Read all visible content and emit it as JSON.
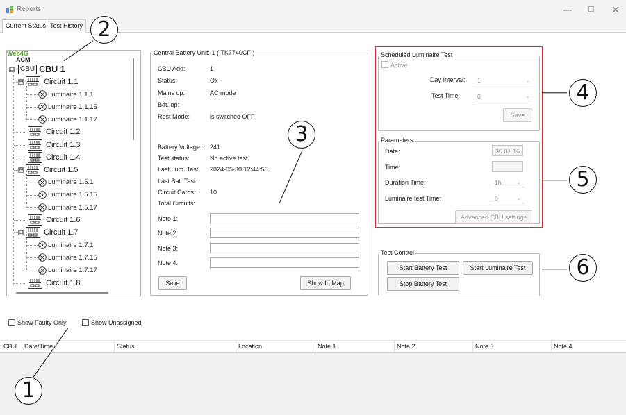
{
  "window": {
    "title": "Reports",
    "minimize_glyph": "—",
    "maximize_glyph": "☐",
    "close_glyph": "✕"
  },
  "tabs": [
    {
      "label": "Current Status",
      "selected": true
    },
    {
      "label": "Test History",
      "selected": false
    }
  ],
  "tree": {
    "brand_web": "Web4G",
    "brand_acm": "ACM",
    "cbu": {
      "icon_text": "CBU",
      "label": "CBU 1",
      "expander": "⊟"
    },
    "nodes": [
      {
        "label": "Circuit 1.1",
        "kind": "circuit",
        "expander": "⊟"
      },
      {
        "label": "Luminaire 1.1.1",
        "kind": "luminaire"
      },
      {
        "label": "Luminaire 1.1.15",
        "kind": "luminaire"
      },
      {
        "label": "Luminaire 1.1.17",
        "kind": "luminaire"
      },
      {
        "label": "Circuit 1.2",
        "kind": "circuit"
      },
      {
        "label": "Circuit 1.3",
        "kind": "circuit"
      },
      {
        "label": "Circuit 1.4",
        "kind": "circuit"
      },
      {
        "label": "Circuit 1.5",
        "kind": "circuit",
        "expander": "⊟"
      },
      {
        "label": "Luminaire 1.5.1",
        "kind": "luminaire"
      },
      {
        "label": "Luminaire 1.5.15",
        "kind": "luminaire"
      },
      {
        "label": "Luminaire 1.5.17",
        "kind": "luminaire"
      },
      {
        "label": "Circuit 1.6",
        "kind": "circuit"
      },
      {
        "label": "Circuit 1.7",
        "kind": "circuit",
        "expander": "⊟"
      },
      {
        "label": "Luminaire 1.7.1",
        "kind": "luminaire"
      },
      {
        "label": "Luminaire 1.7.15",
        "kind": "luminaire"
      },
      {
        "label": "Luminaire 1.7.17",
        "kind": "luminaire"
      },
      {
        "label": "Circuit 1.8",
        "kind": "circuit"
      }
    ]
  },
  "filters": {
    "show_faulty_only": "Show Faulty Only",
    "show_unassigned": "Show Unassigned"
  },
  "cbu_panel": {
    "title": "Central Battery Unit: 1 ( TK7740CF )",
    "rows": [
      {
        "label": "CBU Add:",
        "value": "1"
      },
      {
        "label": "Status:",
        "value": "Ok"
      },
      {
        "label": "Mains op:",
        "value": "AC mode"
      },
      {
        "label": "Bat. op:",
        "value": ""
      },
      {
        "label": "Rest Mode:",
        "value": "is switched OFF"
      }
    ],
    "rows2": [
      {
        "label": "Battery Voltage:",
        "value": "241"
      },
      {
        "label": "Test status:",
        "value": "No active test"
      },
      {
        "label": "Last Lum. Test:",
        "value": "2024-05-30 12:44:56"
      },
      {
        "label": "Last Bat. Test:",
        "value": ""
      },
      {
        "label": "Circuit Cards:",
        "value": "10"
      },
      {
        "label": "Total Circuits:",
        "value": ""
      }
    ],
    "notes": [
      {
        "label": "Note 1:",
        "value": ""
      },
      {
        "label": "Note 2:",
        "value": ""
      },
      {
        "label": "Note 3:",
        "value": ""
      },
      {
        "label": "Note 4:",
        "value": ""
      }
    ],
    "save_label": "Save",
    "show_in_map_label": "Show In Map"
  },
  "scheduled_test": {
    "title": "Scheduled Luminaire Test",
    "active_label": "Active",
    "day_interval_label": "Day Interval:",
    "day_interval_value": "1",
    "test_time_label": "Test Time:",
    "test_time_value": "0",
    "save_label": "Save"
  },
  "parameters": {
    "title": "Parameters",
    "date_label": "Date:",
    "date_value": "30.01.16",
    "time_label": "Time:",
    "time_value": "",
    "duration_label": "Duration Time:",
    "duration_value": "1h",
    "lum_test_time_label": "Luminaire test Time:",
    "lum_test_time_value": "0",
    "advanced_label": "Advanced CBU settings"
  },
  "test_control": {
    "title": "Test Control",
    "start_battery_label": "Start Battery Test",
    "start_luminaire_label": "Start Luminaire Test",
    "stop_battery_label": "Stop Battery Test"
  },
  "table": {
    "columns": [
      "CBU",
      "Date/Time",
      "Status",
      "Location",
      "Note 1",
      "Note 2",
      "Note 3",
      "Note 4"
    ]
  },
  "callouts": [
    "1",
    "2",
    "3",
    "4",
    "5",
    "6"
  ],
  "colors": {
    "highlight_frame": "#d12d3a",
    "brand_green": "#5aa02c",
    "window_chrome": "#f3f3f3"
  },
  "icons": {
    "app": "app-logo-icon",
    "circuit": "circuit-card-icon",
    "luminaire": "luminaire-icon",
    "expander": "tree-collapse-icon"
  }
}
